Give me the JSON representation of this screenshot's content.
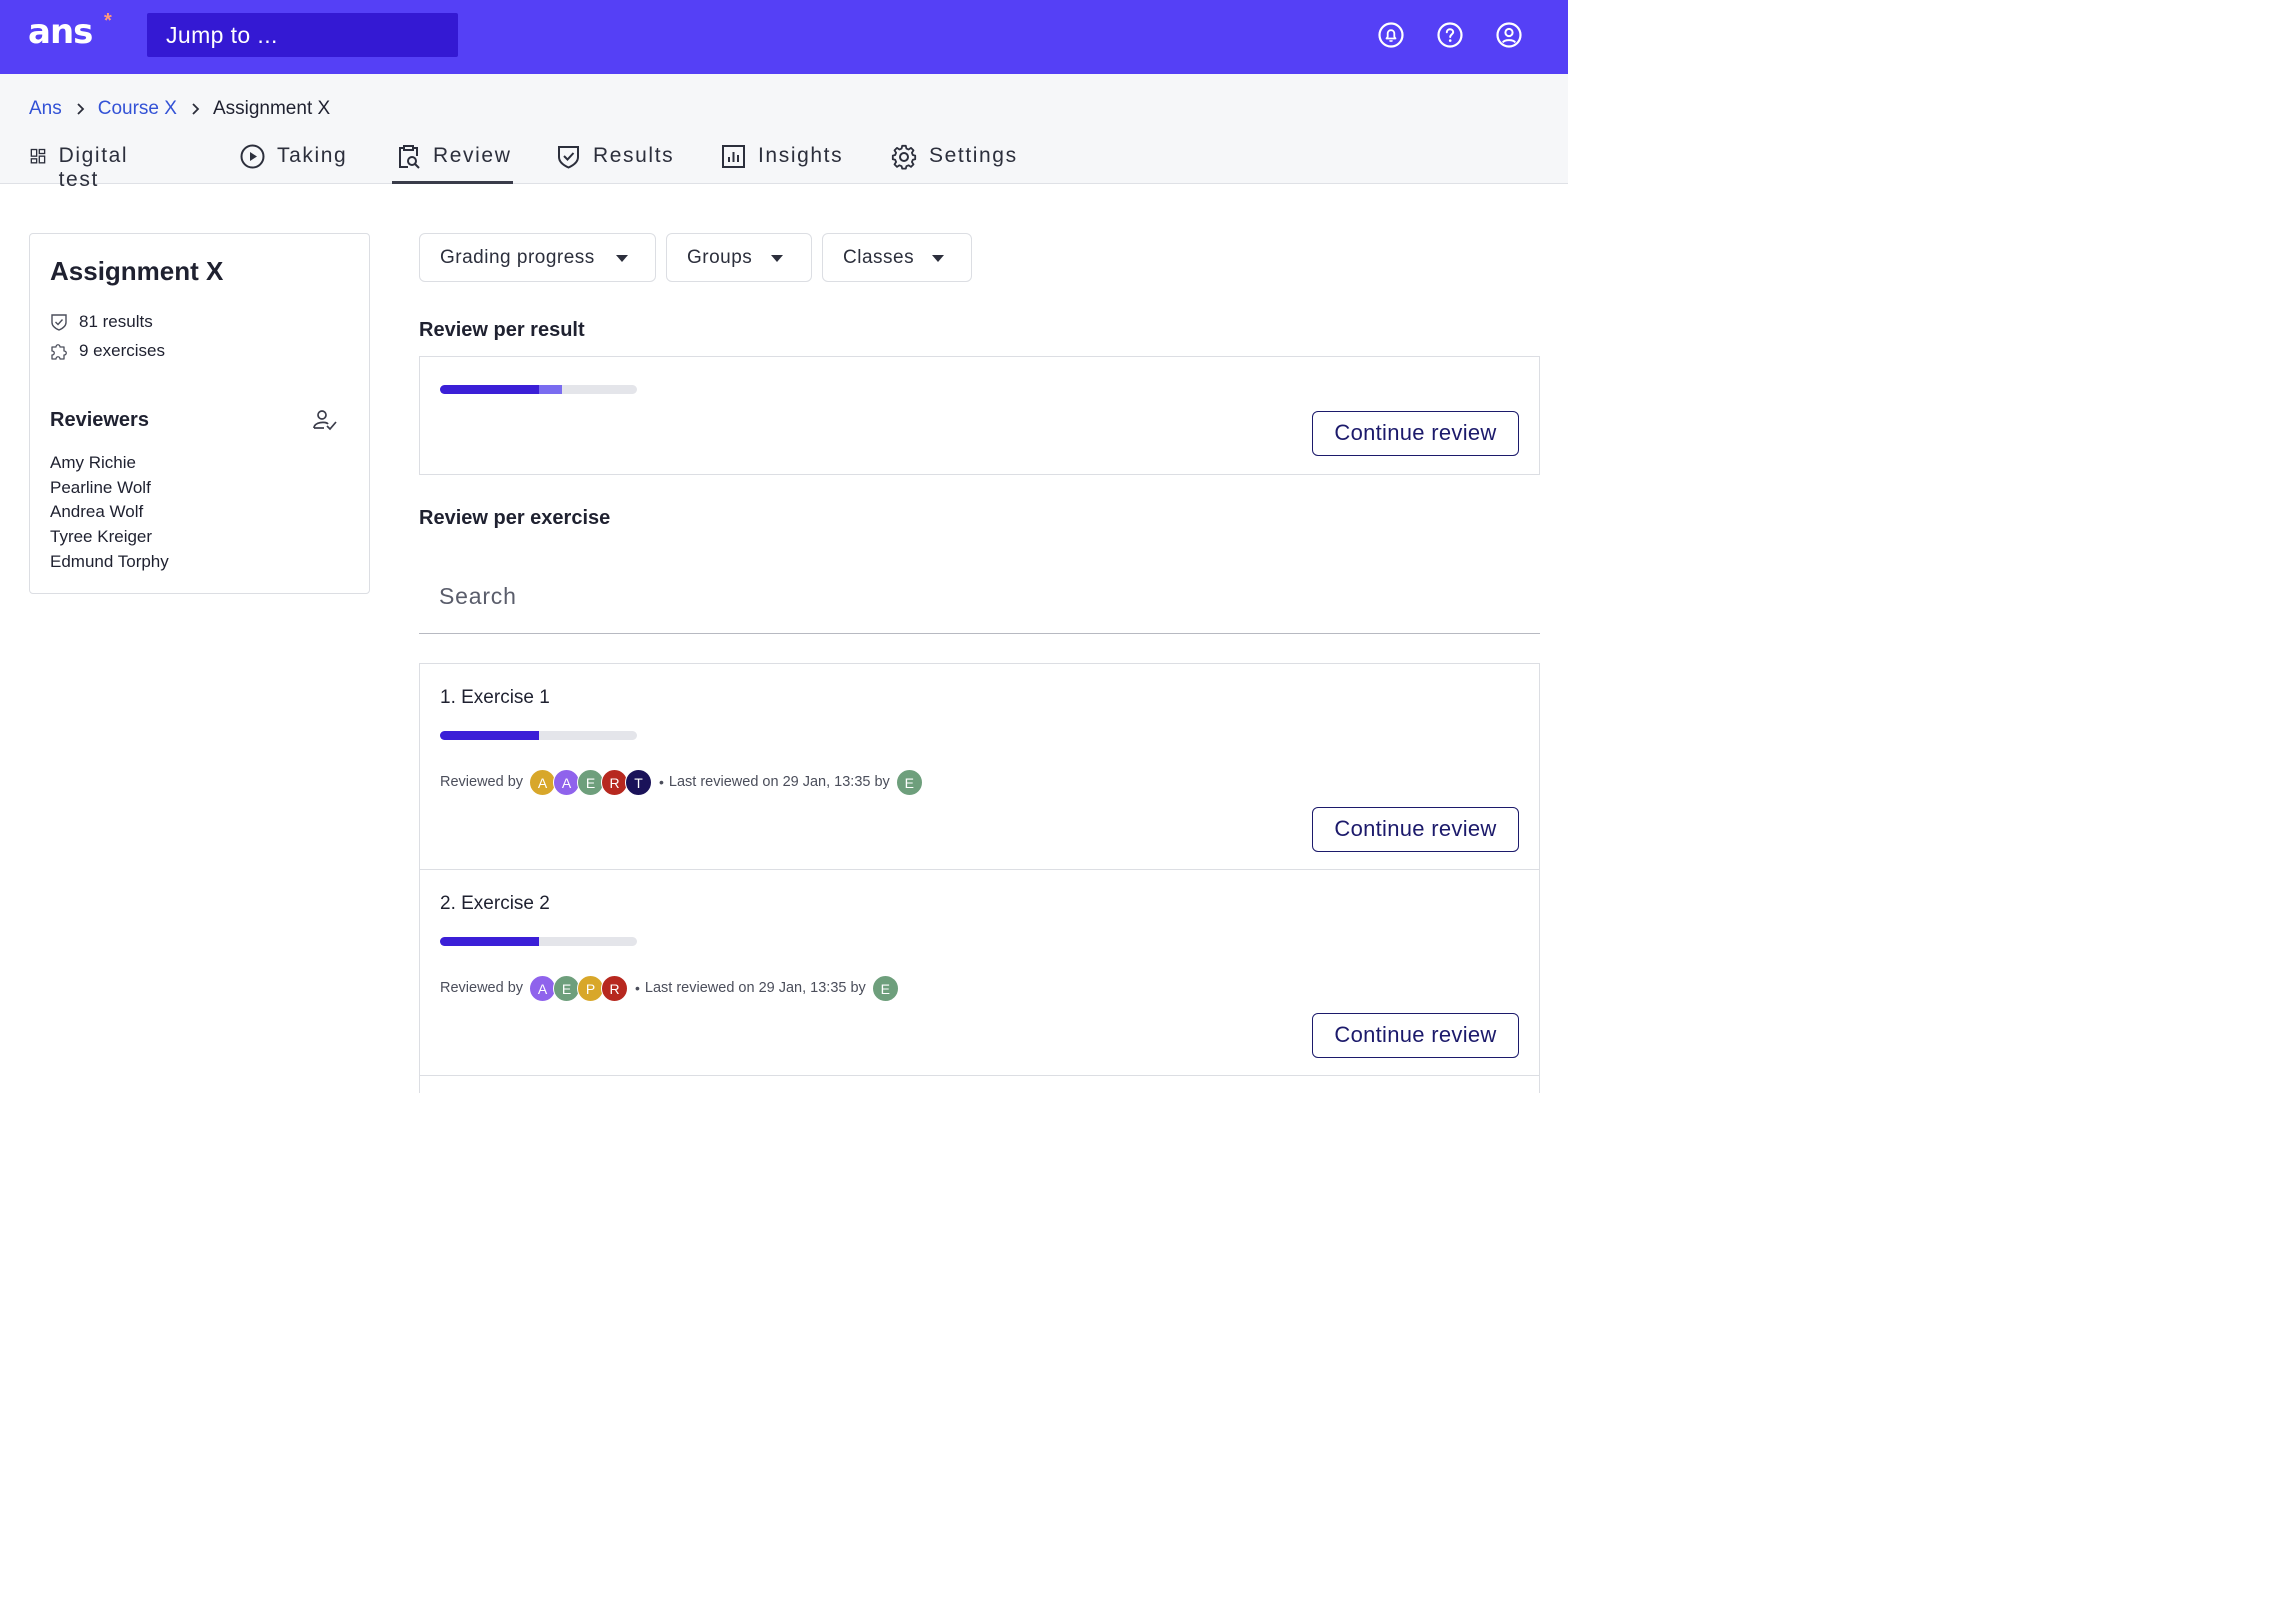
{
  "header": {
    "logo_text": "ans",
    "logo_mark": "*",
    "jump_placeholder": "Jump to ...",
    "icons": [
      "notifications-icon",
      "help-icon",
      "account-icon"
    ]
  },
  "breadcrumb": [
    "Ans",
    "Course X",
    "Assignment X"
  ],
  "tabs": [
    {
      "label": "Digital test",
      "icon": "dashboard-icon"
    },
    {
      "label": "Taking",
      "icon": "play-icon"
    },
    {
      "label": "Review",
      "icon": "clipboard-search-icon",
      "active": true
    },
    {
      "label": "Results",
      "icon": "shield-check-icon"
    },
    {
      "label": "Insights",
      "icon": "bar-chart-icon"
    },
    {
      "label": "Settings",
      "icon": "gear-icon"
    }
  ],
  "sidebar": {
    "title": "Assignment X",
    "results": "81 results",
    "exercises": "9 exercises",
    "reviewers_heading": "Reviewers",
    "reviewers": [
      "Amy Richie",
      "Pearline Wolf",
      "Andrea Wolf",
      "Tyree Kreiger",
      "Edmund Torphy"
    ]
  },
  "filters": [
    "Grading progress",
    "Groups",
    "Classes"
  ],
  "review_per_result": {
    "title": "Review per result",
    "progress_primary": 0.5,
    "progress_secondary": 0.62,
    "button": "Continue review"
  },
  "review_per_exercise": {
    "title": "Review per exercise",
    "search_placeholder": "Search",
    "exercises": [
      {
        "title": "1. Exercise 1",
        "progress": 0.5,
        "reviewed_by_label": "Reviewed by",
        "reviewers": [
          {
            "initial": "A",
            "color": "#d8a72a"
          },
          {
            "initial": "A",
            "color": "#8f63ec"
          },
          {
            "initial": "E",
            "color": "#6e9f7c"
          },
          {
            "initial": "R",
            "color": "#b7281f"
          },
          {
            "initial": "T",
            "color": "#1a1259"
          }
        ],
        "last_reviewed": "Last reviewed on 29 Jan, 13:35 by",
        "last_reviewer": {
          "initial": "E",
          "color": "#6e9f7c"
        },
        "button": "Continue review"
      },
      {
        "title": "2. Exercise 2",
        "progress": 0.5,
        "reviewed_by_label": "Reviewed by",
        "reviewers": [
          {
            "initial": "A",
            "color": "#8f63ec"
          },
          {
            "initial": "E",
            "color": "#6e9f7c"
          },
          {
            "initial": "P",
            "color": "#d8a72a"
          },
          {
            "initial": "R",
            "color": "#b7281f"
          }
        ],
        "last_reviewed": "Last reviewed on 29 Jan, 13:35 by",
        "last_reviewer": {
          "initial": "E",
          "color": "#6e9f7c"
        },
        "button": "Continue review"
      }
    ]
  },
  "colors": {
    "brand": "#5540f6",
    "brand_dark": "#3419d3",
    "progress": "#3b1fd7",
    "progress_light": "#7a6cf0",
    "button_text": "#1c1a6b",
    "link": "#3352d6"
  }
}
